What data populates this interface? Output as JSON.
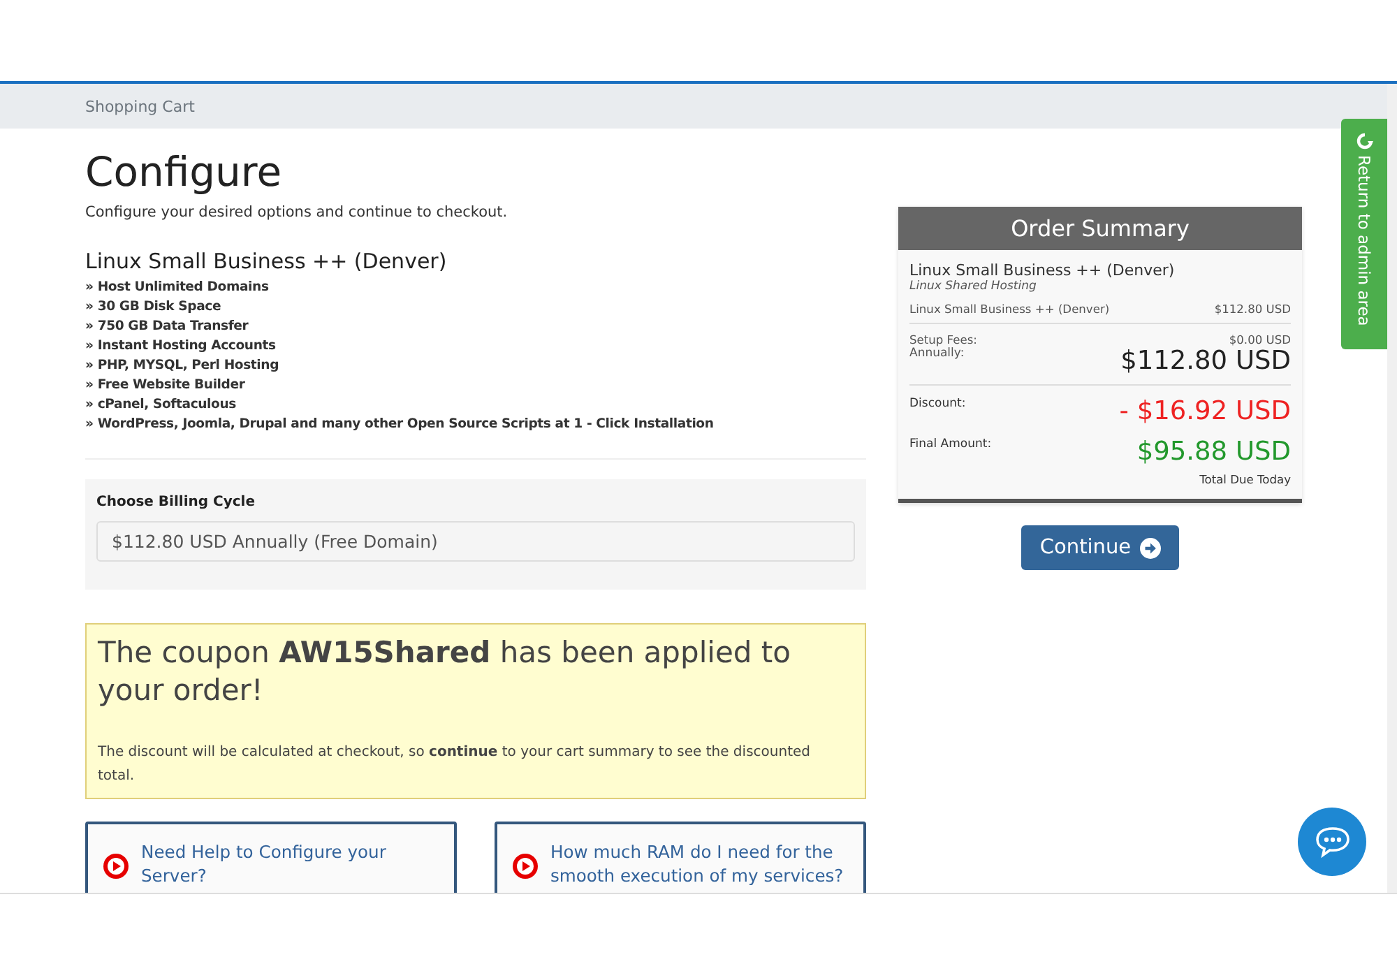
{
  "breadcrumb": "Shopping Cart",
  "page": {
    "title": "Configure",
    "subtitle": "Configure your desired options and continue to checkout."
  },
  "product": {
    "name": "Linux Small Business ++ (Denver)",
    "features": [
      "» Host Unlimited Domains",
      "» 30 GB Disk Space",
      "» 750 GB Data Transfer",
      "» Instant Hosting Accounts",
      "» PHP, MYSQL, Perl Hosting",
      "» Free Website Builder",
      "» cPanel, Softaculous",
      "» WordPress, Joomla, Drupal and many other Open Source Scripts at 1 - Click Installation"
    ]
  },
  "billing": {
    "label": "Choose Billing Cycle",
    "value": "$112.80 USD Annually (Free Domain)"
  },
  "coupon": {
    "heading": "The coupon **AW15Shared** has been applied to your order!",
    "note": "The discount will be calculated at checkout, so **continue** to your cart summary to see the discounted total."
  },
  "help_links": [
    "Need Help to Configure your Server?",
    "How much RAM do I need for the smooth execution of my services?"
  ],
  "summary": {
    "title": "Order Summary",
    "product": "Linux Small Business ++ (Denver)",
    "group": "Linux Shared Hosting",
    "line_label": "Linux Small Business ++ (Denver)",
    "line_price": "$112.80 USD",
    "setup_label": "Setup Fees:",
    "setup_value": "$0.00 USD",
    "cycle_label": "Annually:",
    "cycle_value": "$112.80 USD",
    "discount_label": "Discount:",
    "discount_value": "- $16.92 USD",
    "final_label": "Final Amount:",
    "final_value": "$95.88 USD",
    "due_label": "Total Due Today"
  },
  "continue_button": "Continue",
  "admin_tab": "Return to admin area"
}
